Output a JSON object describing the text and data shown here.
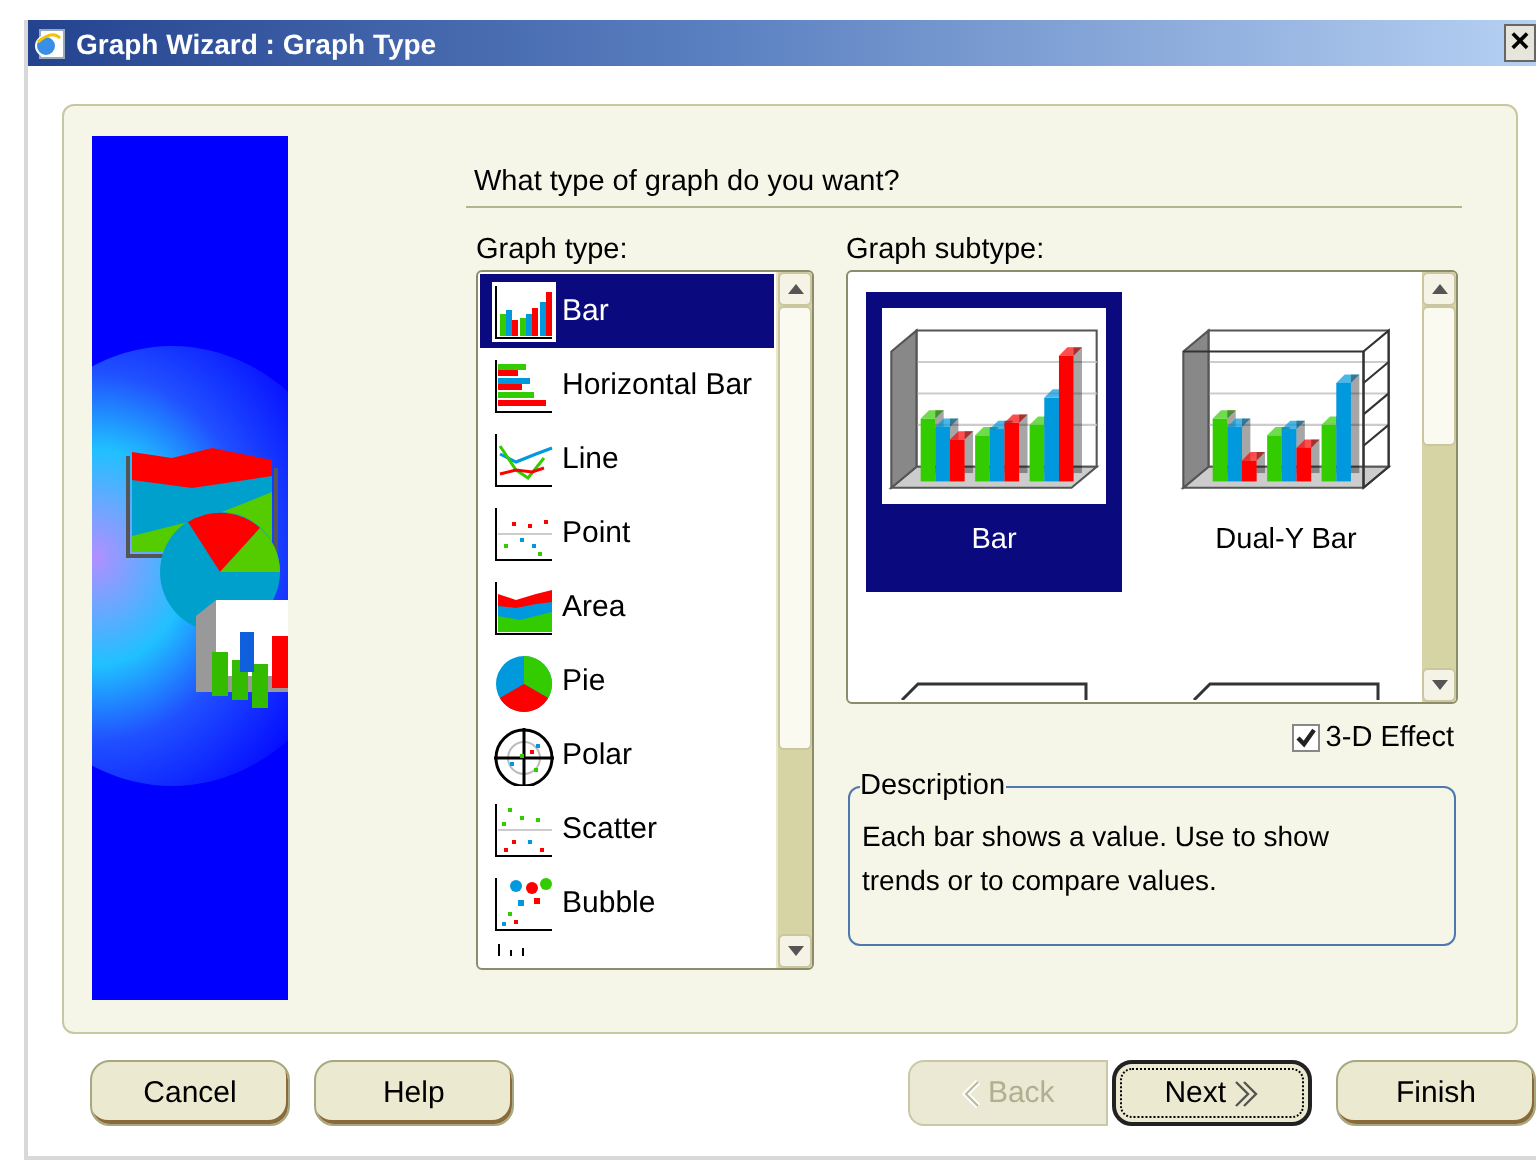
{
  "window": {
    "title": "Graph Wizard : Graph Type",
    "close": "×"
  },
  "question": "What type of graph do you want?",
  "graph_type": {
    "label": "Graph type:",
    "items": [
      {
        "label": "Bar",
        "kind": "bar",
        "selected": true
      },
      {
        "label": "Horizontal Bar",
        "kind": "hbar",
        "selected": false
      },
      {
        "label": "Line",
        "kind": "line",
        "selected": false
      },
      {
        "label": "Point",
        "kind": "point",
        "selected": false
      },
      {
        "label": "Area",
        "kind": "area",
        "selected": false
      },
      {
        "label": "Pie",
        "kind": "pie",
        "selected": false
      },
      {
        "label": "Polar",
        "kind": "polar",
        "selected": false
      },
      {
        "label": "Scatter",
        "kind": "scatter",
        "selected": false
      },
      {
        "label": "Bubble",
        "kind": "bubble",
        "selected": false
      }
    ]
  },
  "graph_subtype": {
    "label": "Graph subtype:",
    "items": [
      {
        "label": "Bar",
        "kind": "bar",
        "selected": true
      },
      {
        "label": "Dual-Y Bar",
        "kind": "dual",
        "selected": false
      }
    ]
  },
  "effect_3d": {
    "label": "3-D Effect",
    "checked": true
  },
  "description": {
    "legend": "Description",
    "text": "Each bar shows a value. Use to show trends or to compare values."
  },
  "buttons": [
    {
      "label": "Cancel",
      "kind": "plain",
      "disabled": false,
      "focused": false
    },
    {
      "label": "Help",
      "kind": "plain",
      "disabled": false,
      "focused": false
    },
    {
      "label": "Back",
      "kind": "back",
      "disabled": true,
      "focused": false
    },
    {
      "label": "Next",
      "kind": "next",
      "disabled": false,
      "focused": true
    },
    {
      "label": "Finish",
      "kind": "plain",
      "disabled": false,
      "focused": false
    }
  ]
}
